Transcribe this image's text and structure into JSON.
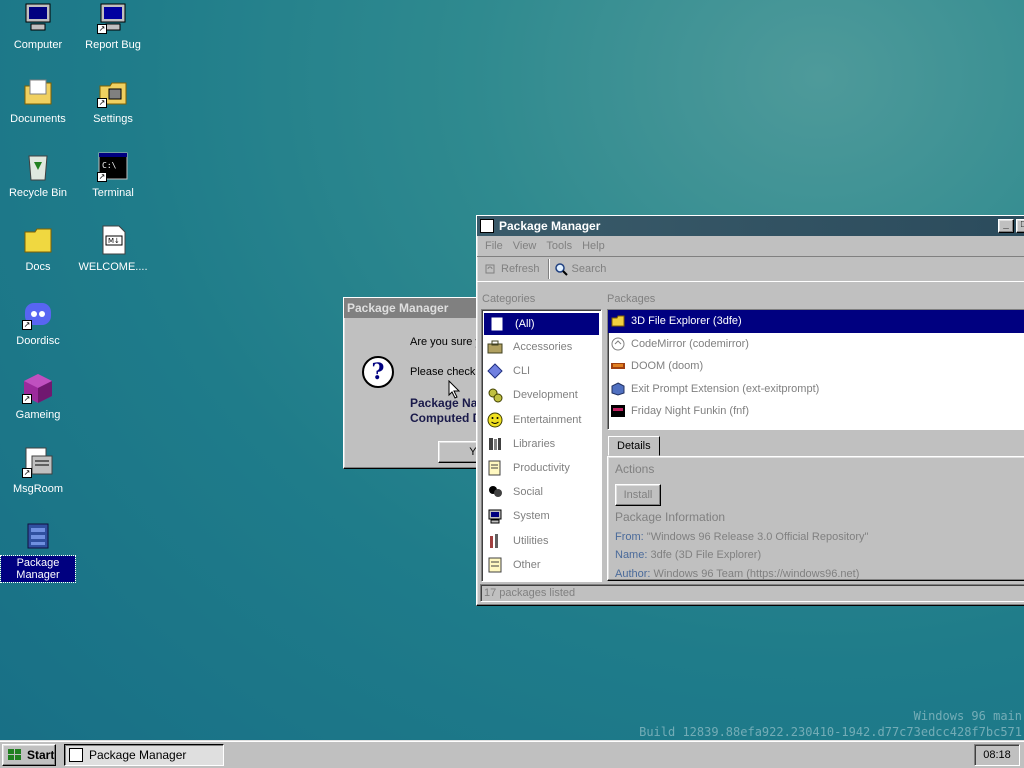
{
  "desktop": {
    "icons": [
      {
        "label": "Computer"
      },
      {
        "label": "Report Bug"
      },
      {
        "label": "Documents"
      },
      {
        "label": "Settings"
      },
      {
        "label": "Recycle Bin"
      },
      {
        "label": "Terminal"
      },
      {
        "label": "Docs"
      },
      {
        "label": "WELCOME...."
      },
      {
        "label": "Doordisc"
      },
      {
        "label": "Gameing"
      },
      {
        "label": "MsgRoom"
      },
      {
        "label": "Package Manager"
      }
    ],
    "watermark_line1": "Windows 96 main",
    "watermark_line2": "Build 12839.88efa922.230410-1942.d77c73edcc428f7bc571"
  },
  "dialog": {
    "title": "Package Manager",
    "line1": "Are you sure yo",
    "line2": "Please check",
    "bold1": "Package Na",
    "bold2": "Computed D",
    "yes_label": "Ye"
  },
  "package_manager": {
    "title": "Package Manager",
    "menu": [
      "File",
      "View",
      "Tools",
      "Help"
    ],
    "toolbar": {
      "refresh": "Refresh",
      "search": "Search"
    },
    "categories_header": "Categories",
    "packages_header": "Packages",
    "categories": [
      {
        "label": "(All)",
        "selected": true
      },
      {
        "label": "Accessories"
      },
      {
        "label": "CLI"
      },
      {
        "label": "Development"
      },
      {
        "label": "Entertainment"
      },
      {
        "label": "Libraries"
      },
      {
        "label": "Productivity"
      },
      {
        "label": "Social"
      },
      {
        "label": "System"
      },
      {
        "label": "Utilities"
      },
      {
        "label": "Other"
      }
    ],
    "packages": [
      {
        "label": "3D File Explorer (3dfe)",
        "selected": true
      },
      {
        "label": "CodeMirror (codemirror)"
      },
      {
        "label": "DOOM (doom)"
      },
      {
        "label": "Exit Prompt Extension (ext-exitprompt)"
      },
      {
        "label": "Friday Night Funkin (fnf)"
      }
    ],
    "details_tab": "Details",
    "actions_label": "Actions",
    "install_label": "Install",
    "info_header": "Package Information",
    "info": {
      "from_key": "From:",
      "from_val": "\"Windows 96 Release 3.0 Official Repository\"",
      "name_key": "Name:",
      "name_val": "3dfe (3D File Explorer)",
      "author_key": "Author:",
      "author_val": "Windows 96 Team (https://windows96.net)"
    },
    "status": "17 packages listed"
  },
  "taskbar": {
    "start_label": "Start",
    "task_label": "Package Manager",
    "clock": "08:18"
  }
}
